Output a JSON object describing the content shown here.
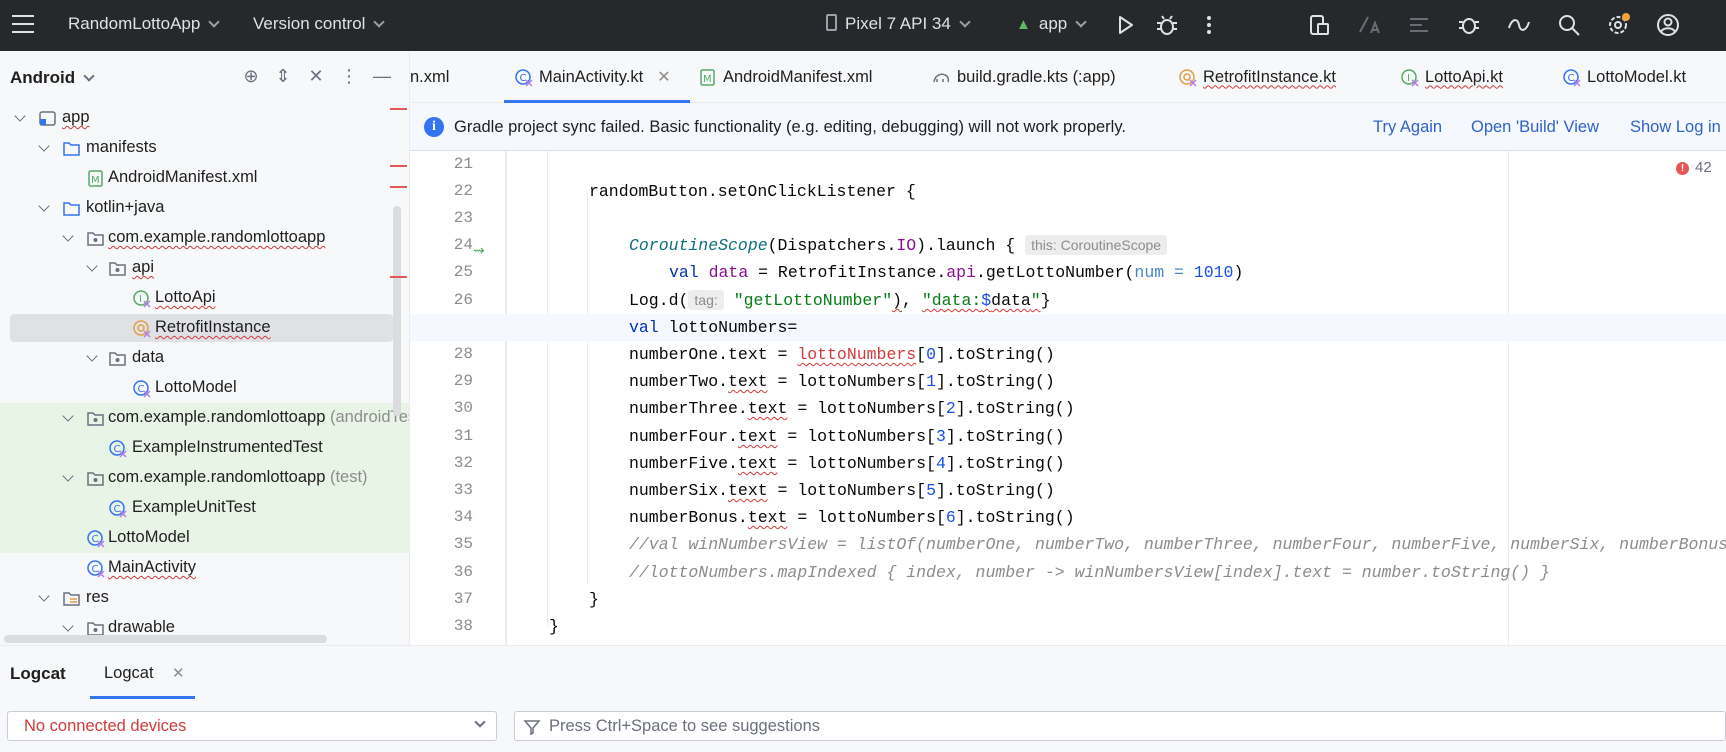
{
  "topbar": {
    "project": "RandomLottoApp",
    "vcs": "Version control",
    "device": "Pixel 7 API 34",
    "run_config": "app"
  },
  "project_panel": {
    "title": "Android",
    "tree": [
      {
        "label": "app",
        "icon": "module-icon",
        "error": true
      },
      {
        "label": "manifests",
        "icon": "folder-icon"
      },
      {
        "label": "AndroidManifest.xml",
        "icon": "manifest-file-icon"
      },
      {
        "label": "kotlin+java",
        "icon": "folder-icon"
      },
      {
        "label": "com.example.randomlottoapp",
        "icon": "package-icon",
        "error": true
      },
      {
        "label": "api",
        "icon": "package-icon",
        "error": true
      },
      {
        "label": "LottoApi",
        "icon": "kotlin-interface-icon",
        "error": true
      },
      {
        "label": "RetrofitInstance",
        "icon": "kotlin-object-icon",
        "error": true
      },
      {
        "label": "data",
        "icon": "package-icon"
      },
      {
        "label": "LottoModel",
        "icon": "kotlin-class-icon"
      },
      {
        "label": "com.example.randomlottoapp",
        "suffix": "(androidTest)",
        "icon": "package-icon"
      },
      {
        "label": "ExampleInstrumentedTest",
        "icon": "kotlin-class-icon"
      },
      {
        "label": "com.example.randomlottoapp",
        "suffix": "(test)",
        "icon": "package-icon"
      },
      {
        "label": "ExampleUnitTest",
        "icon": "kotlin-class-icon"
      },
      {
        "label": "LottoModel",
        "icon": "kotlin-class-icon"
      },
      {
        "label": "MainActivity",
        "icon": "kotlin-class-icon",
        "error": true
      },
      {
        "label": "res",
        "icon": "res-folder-icon"
      },
      {
        "label": "drawable",
        "icon": "package-icon"
      }
    ]
  },
  "tabs": [
    {
      "label": "n.xml",
      "icon": ""
    },
    {
      "label": "MainActivity.kt",
      "icon": "kotlin-class-icon",
      "active": true
    },
    {
      "label": "AndroidManifest.xml",
      "icon": "manifest-file-icon"
    },
    {
      "label": "build.gradle.kts (:app)",
      "icon": "gradle-icon"
    },
    {
      "label": "RetrofitInstance.kt",
      "icon": "kotlin-object-icon",
      "error": true
    },
    {
      "label": "LottoApi.kt",
      "icon": "kotlin-interface-icon",
      "error": true
    },
    {
      "label": "LottoModel.kt",
      "icon": "kotlin-class-icon"
    }
  ],
  "notification": {
    "message": "Gradle project sync failed. Basic functionality (e.g. editing, debugging) will not work properly.",
    "try_again": "Try Again",
    "open_build": "Open 'Build' View",
    "show_log": "Show Log in"
  },
  "editor": {
    "error_count": "42",
    "line_numbers": [
      "21",
      "22",
      "23",
      "24",
      "25",
      "26",
      "27",
      "28",
      "29",
      "30",
      "31",
      "32",
      "33",
      "34",
      "35",
      "36",
      "37",
      "38"
    ],
    "hint_this": "this: CoroutineScope",
    "hint_tag": "tag:"
  },
  "logcat": {
    "title": "Logcat",
    "tab": "Logcat",
    "device_status": "No connected devices",
    "filter_placeholder": "Press Ctrl+Space to see suggestions"
  },
  "colors": {
    "accent": "#3574f0",
    "error": "#d23b3b",
    "test_bg": "#e8f4e6"
  }
}
